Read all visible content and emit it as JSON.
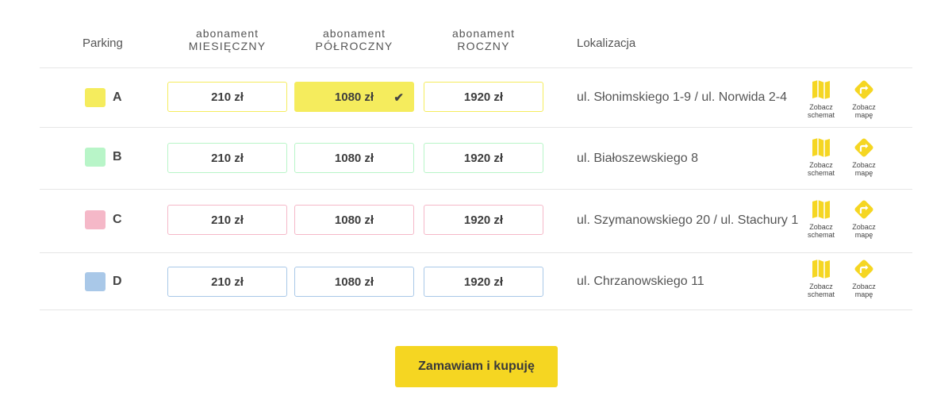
{
  "header": {
    "parking": "Parking",
    "col1_l1": "abonament",
    "col1_l2": "MIESIĘCZNY",
    "col2_l1": "abonament",
    "col2_l2": "PÓŁROCZNY",
    "col3_l1": "abonament",
    "col3_l2": "ROCZNY",
    "location": "Lokalizacja"
  },
  "rows": [
    {
      "letter": "A",
      "color": "#f5ec5d",
      "prices": [
        "210 zł",
        "1080 zł",
        "1920 zł"
      ],
      "selected_index": 1,
      "location": "ul. Słonimskiego 1-9 / ul. Norwida 2-4",
      "scheme_label_1": "Zobacz",
      "scheme_label_2": "schemat",
      "map_label_1": "Zobacz",
      "map_label_2": "mapę"
    },
    {
      "letter": "B",
      "color": "#b8f5c8",
      "prices": [
        "210 zł",
        "1080 zł",
        "1920 zł"
      ],
      "selected_index": -1,
      "location": "ul. Białoszewskiego 8",
      "scheme_label_1": "Zobacz",
      "scheme_label_2": "schemat",
      "map_label_1": "Zobacz",
      "map_label_2": "mapę"
    },
    {
      "letter": "C",
      "color": "#f5b8c8",
      "prices": [
        "210 zł",
        "1080 zł",
        "1920 zł"
      ],
      "selected_index": -1,
      "location": "ul. Szymanowskiego 20 / ul. Stachury 1",
      "scheme_label_1": "Zobacz",
      "scheme_label_2": "schemat",
      "map_label_1": "Zobacz",
      "map_label_2": "mapę"
    },
    {
      "letter": "D",
      "color": "#a9c8e8",
      "prices": [
        "210 zł",
        "1080 zł",
        "1920 zł"
      ],
      "selected_index": -1,
      "location": "ul. Chrzanowskiego 11",
      "scheme_label_1": "Zobacz",
      "scheme_label_2": "schemat",
      "map_label_1": "Zobacz",
      "map_label_2": "mapę"
    }
  ],
  "icons": {
    "scheme": "map-icon",
    "map": "directions-icon",
    "selected": "check-icon"
  },
  "accent_color": "#f5d622",
  "buy_button": "Zamawiam i kupuję"
}
